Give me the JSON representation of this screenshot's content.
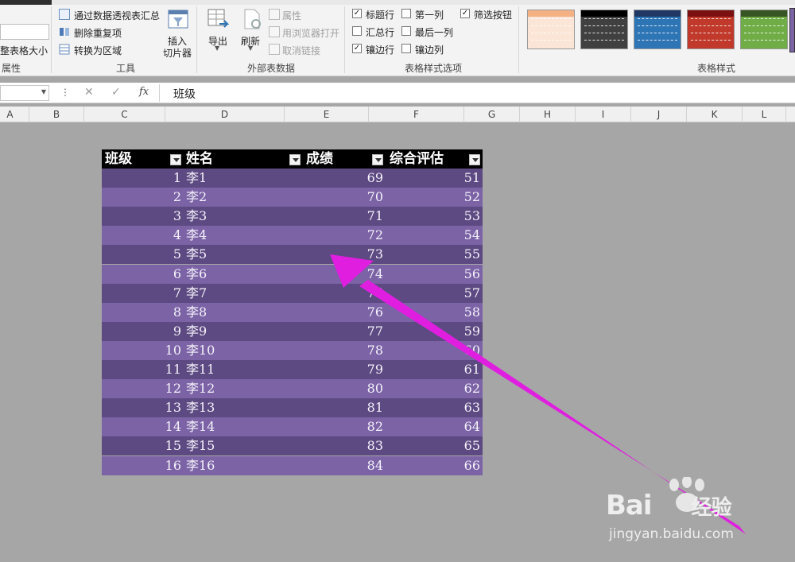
{
  "ribbon": {
    "properties_group": {
      "label": "属性",
      "resize_label": "整表格大小"
    },
    "tools_group": {
      "label": "工具",
      "pivot_label": "通过数据透视表汇总",
      "remove_dup_label": "删除重复项",
      "convert_label": "转换为区域",
      "slicer_label_1": "插入",
      "slicer_label_2": "切片器"
    },
    "external_group": {
      "label": "外部表数据",
      "export_label": "导出",
      "refresh_label": "刷新",
      "props_label": "属性",
      "browser_label": "用浏览器打开",
      "unlink_label": "取消链接"
    },
    "style_options_group": {
      "label": "表格样式选项",
      "header_row": "标题行",
      "total_row": "汇总行",
      "banded_rows": "镶边行",
      "first_col": "第一列",
      "last_col": "最后一列",
      "banded_cols": "镶边列",
      "filter_btn": "筛选按钮",
      "check_mark": "✓"
    },
    "styles_group": {
      "label": "表格样式",
      "swatches": [
        {
          "header": "#f4b183",
          "body": "#fbe5d6"
        },
        {
          "header": "#000000",
          "body": "#404040"
        },
        {
          "header": "#1f3864",
          "body": "#2e75b6"
        },
        {
          "header": "#7b1010",
          "body": "#c0392b"
        },
        {
          "header": "#375623",
          "body": "#70ad47"
        },
        {
          "header": "#3f3151",
          "body": "#7b63a6"
        }
      ]
    }
  },
  "formula_bar": {
    "cancel": "✕",
    "enter": "✓",
    "fx": "fx",
    "content": "班级"
  },
  "columns": [
    "A",
    "B",
    "C",
    "D",
    "E",
    "F",
    "G",
    "H",
    "I",
    "J",
    "K",
    "L"
  ],
  "table": {
    "headers": [
      "班级",
      "姓名",
      "成绩",
      "综合评估"
    ],
    "rows": [
      [
        "1",
        "李1",
        "69",
        "51"
      ],
      [
        "2",
        "李2",
        "70",
        "52"
      ],
      [
        "3",
        "李3",
        "71",
        "53"
      ],
      [
        "4",
        "李4",
        "72",
        "54"
      ],
      [
        "5",
        "李5",
        "73",
        "55"
      ],
      [
        "6",
        "李6",
        "74",
        "56"
      ],
      [
        "7",
        "李7",
        "75",
        "57"
      ],
      [
        "8",
        "李8",
        "76",
        "58"
      ],
      [
        "9",
        "李9",
        "77",
        "59"
      ],
      [
        "10",
        "李10",
        "78",
        "60"
      ],
      [
        "11",
        "李11",
        "79",
        "61"
      ],
      [
        "12",
        "李12",
        "80",
        "62"
      ],
      [
        "13",
        "李13",
        "81",
        "63"
      ],
      [
        "14",
        "李14",
        "82",
        "64"
      ],
      [
        "15",
        "李15",
        "83",
        "65"
      ],
      [
        "16",
        "李16",
        "84",
        "66"
      ]
    ]
  },
  "colors": {
    "band_dark": "#5d4a82",
    "band_light": "#7b63a6",
    "arrow": "#e01ee0"
  },
  "watermark": {
    "brand_prefix": "Bai",
    "brand_suffix": "经验",
    "url": "jingyan.baidu.com"
  }
}
